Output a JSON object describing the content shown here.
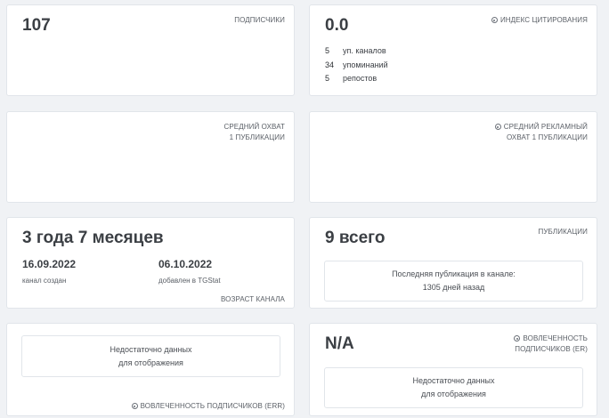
{
  "subscribers": {
    "value": "107",
    "label": "ПОДПИСЧИКИ"
  },
  "citation": {
    "value": "0.0",
    "label": "ИНДЕКС ЦИТИРОВАНИЯ",
    "rows": [
      {
        "num": "5",
        "text": "уп. каналов"
      },
      {
        "num": "34",
        "text": "упоминаний"
      },
      {
        "num": "5",
        "text": "репостов"
      }
    ]
  },
  "avg_reach": {
    "label_line1": "СРЕДНИЙ ОХВАТ",
    "label_line2": "1 ПУБЛИКАЦИИ"
  },
  "avg_ad_reach": {
    "label_line1": "СРЕДНИЙ РЕКЛАМНЫЙ",
    "label_line2": "ОХВАТ 1 ПУБЛИКАЦИИ"
  },
  "channel_age": {
    "value": "3 года 7 месяцев",
    "created_date": "16.09.2022",
    "created_caption": "канал создан",
    "added_date": "06.10.2022",
    "added_caption": "добавлен в TGStat",
    "label": "ВОЗРАСТ КАНАЛА"
  },
  "publications": {
    "value": "9 всего",
    "label": "ПУБЛИКАЦИИ",
    "last_line1": "Последняя публикация в канале:",
    "last_line2": "1305 дней назад"
  },
  "err": {
    "nodata_line1": "Недостаточно данных",
    "nodata_line2": "для отображения",
    "label": "ВОВЛЕЧЕННОСТЬ ПОДПИСЧИКОВ (ERR)"
  },
  "er": {
    "value": "N/A",
    "label_line1": "ВОВЛЕЧЕННОСТЬ",
    "label_line2": "ПОДПИСЧИКОВ (ER)",
    "nodata_line1": "Недостаточно данных",
    "nodata_line2": "для отображения"
  }
}
